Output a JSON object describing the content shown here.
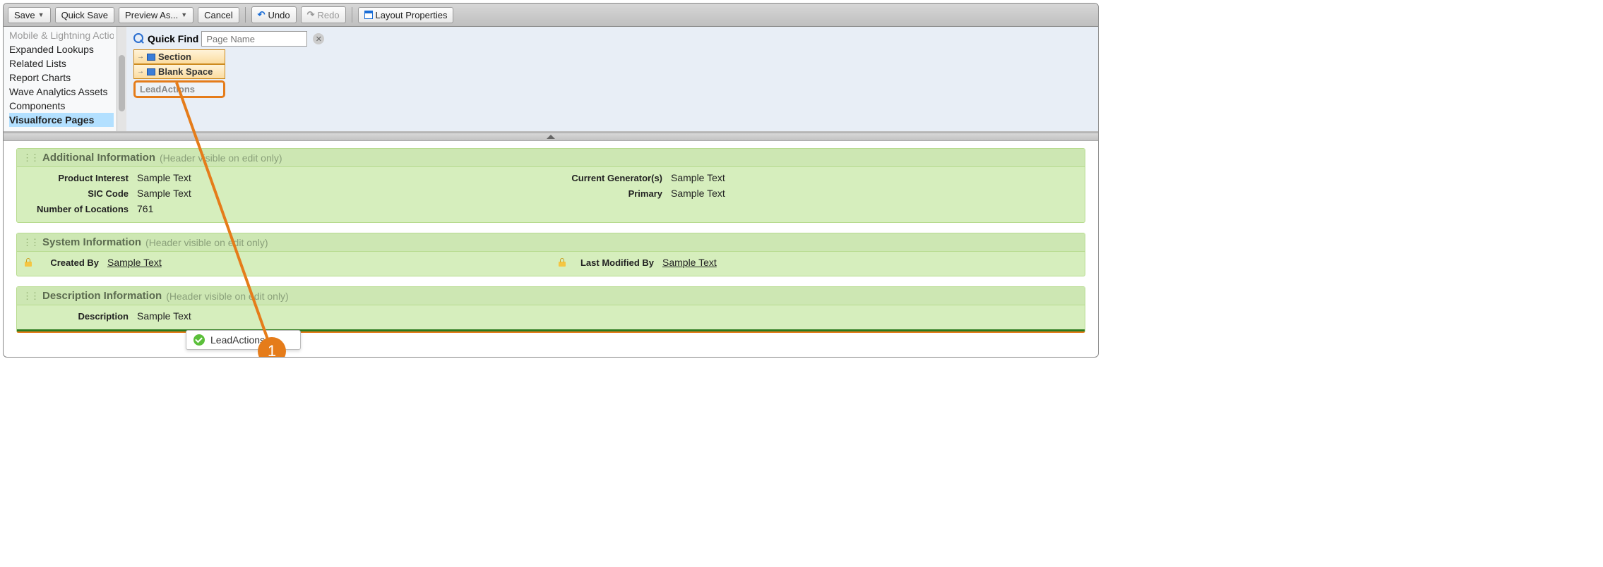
{
  "toolbar": {
    "save": "Save",
    "quick_save": "Quick Save",
    "preview_as": "Preview As...",
    "cancel": "Cancel",
    "undo": "Undo",
    "redo": "Redo",
    "layout_props": "Layout Properties"
  },
  "sidebar": {
    "items": [
      "Mobile & Lightning Actions",
      "Expanded Lookups",
      "Related Lists",
      "Report Charts",
      "Wave Analytics Assets",
      "Components",
      "Visualforce Pages"
    ],
    "selected_index": 6,
    "clipped_index": 0
  },
  "quickfind": {
    "label": "Quick Find",
    "placeholder": "Page Name"
  },
  "palette": {
    "section": "Section",
    "blank_space": "Blank Space",
    "lead_actions": "LeadActions"
  },
  "sections": [
    {
      "title": "Additional Information",
      "note": "(Header visible on edit only)",
      "rows": [
        {
          "l_label": "Product Interest",
          "l_value": "Sample Text",
          "r_label": "Current Generator(s)",
          "r_value": "Sample Text"
        },
        {
          "l_label": "SIC Code",
          "l_value": "Sample Text",
          "r_label": "Primary",
          "r_value": "Sample Text"
        },
        {
          "l_label": "Number of Locations",
          "l_value": "761",
          "r_label": "",
          "r_value": ""
        }
      ]
    },
    {
      "title": "System Information",
      "note": "(Header visible on edit only)",
      "rows": [
        {
          "l_label": "Created By",
          "l_value": "Sample Text",
          "l_lock": true,
          "l_link": true,
          "r_label": "Last Modified By",
          "r_value": "Sample Text",
          "r_lock": true,
          "r_link": true
        }
      ]
    },
    {
      "title": "Description Information",
      "note": "(Header visible on edit only)",
      "rows": [
        {
          "l_label": "Description",
          "l_value": "Sample Text",
          "r_label": "",
          "r_value": ""
        }
      ],
      "drop_active": true
    }
  ],
  "drop_tooltip": "LeadActions",
  "callout": "1"
}
